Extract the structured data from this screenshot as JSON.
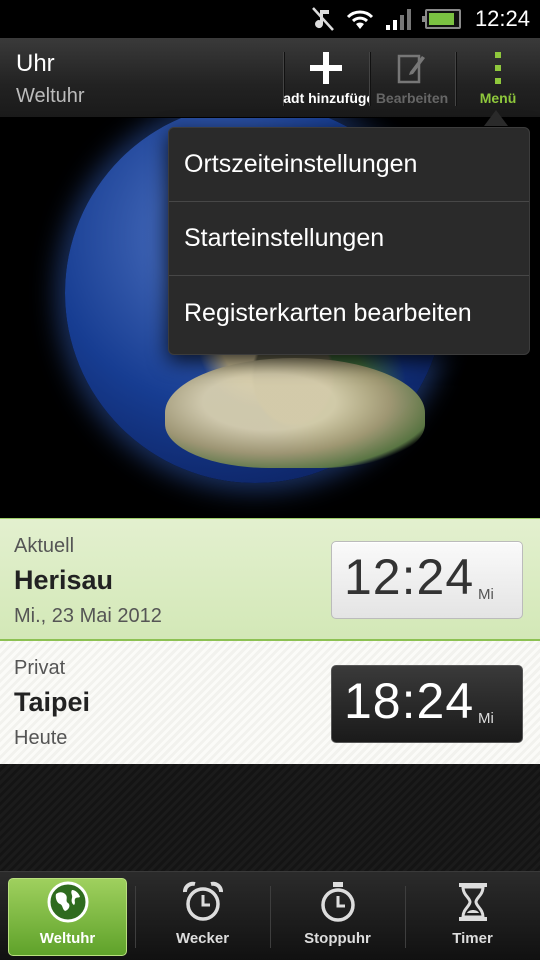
{
  "status_bar": {
    "time": "12:24",
    "icons": [
      "mute-icon",
      "wifi-icon",
      "signal-icon",
      "battery-icon"
    ],
    "battery_level": 0.9
  },
  "action_bar": {
    "title": "Uhr",
    "subtitle": "Weltuhr",
    "add_label": "Stadt hinzufügen",
    "edit_label": "Bearbeiten",
    "menu_label": "Menü",
    "accent_color": "#8fc83c"
  },
  "menu": {
    "items": [
      {
        "label": "Ortszeiteinstellungen"
      },
      {
        "label": "Starteinstellungen"
      },
      {
        "label": "Registerkarten bearbeiten"
      }
    ]
  },
  "cities": [
    {
      "type": "Aktuell",
      "name": "Herisau",
      "date": "Mi., 23 Mai 2012",
      "time": "12:24",
      "day": "Mi"
    },
    {
      "type": "Privat",
      "name": "Taipei",
      "date": "Heute",
      "time": "18:24",
      "day": "Mi"
    }
  ],
  "tabs": [
    {
      "label": "Weltuhr",
      "icon": "globe-icon",
      "active": true
    },
    {
      "label": "Wecker",
      "icon": "alarm-clock-icon",
      "active": false
    },
    {
      "label": "Stoppuhr",
      "icon": "stopwatch-icon",
      "active": false
    },
    {
      "label": "Timer",
      "icon": "hourglass-icon",
      "active": false
    }
  ]
}
